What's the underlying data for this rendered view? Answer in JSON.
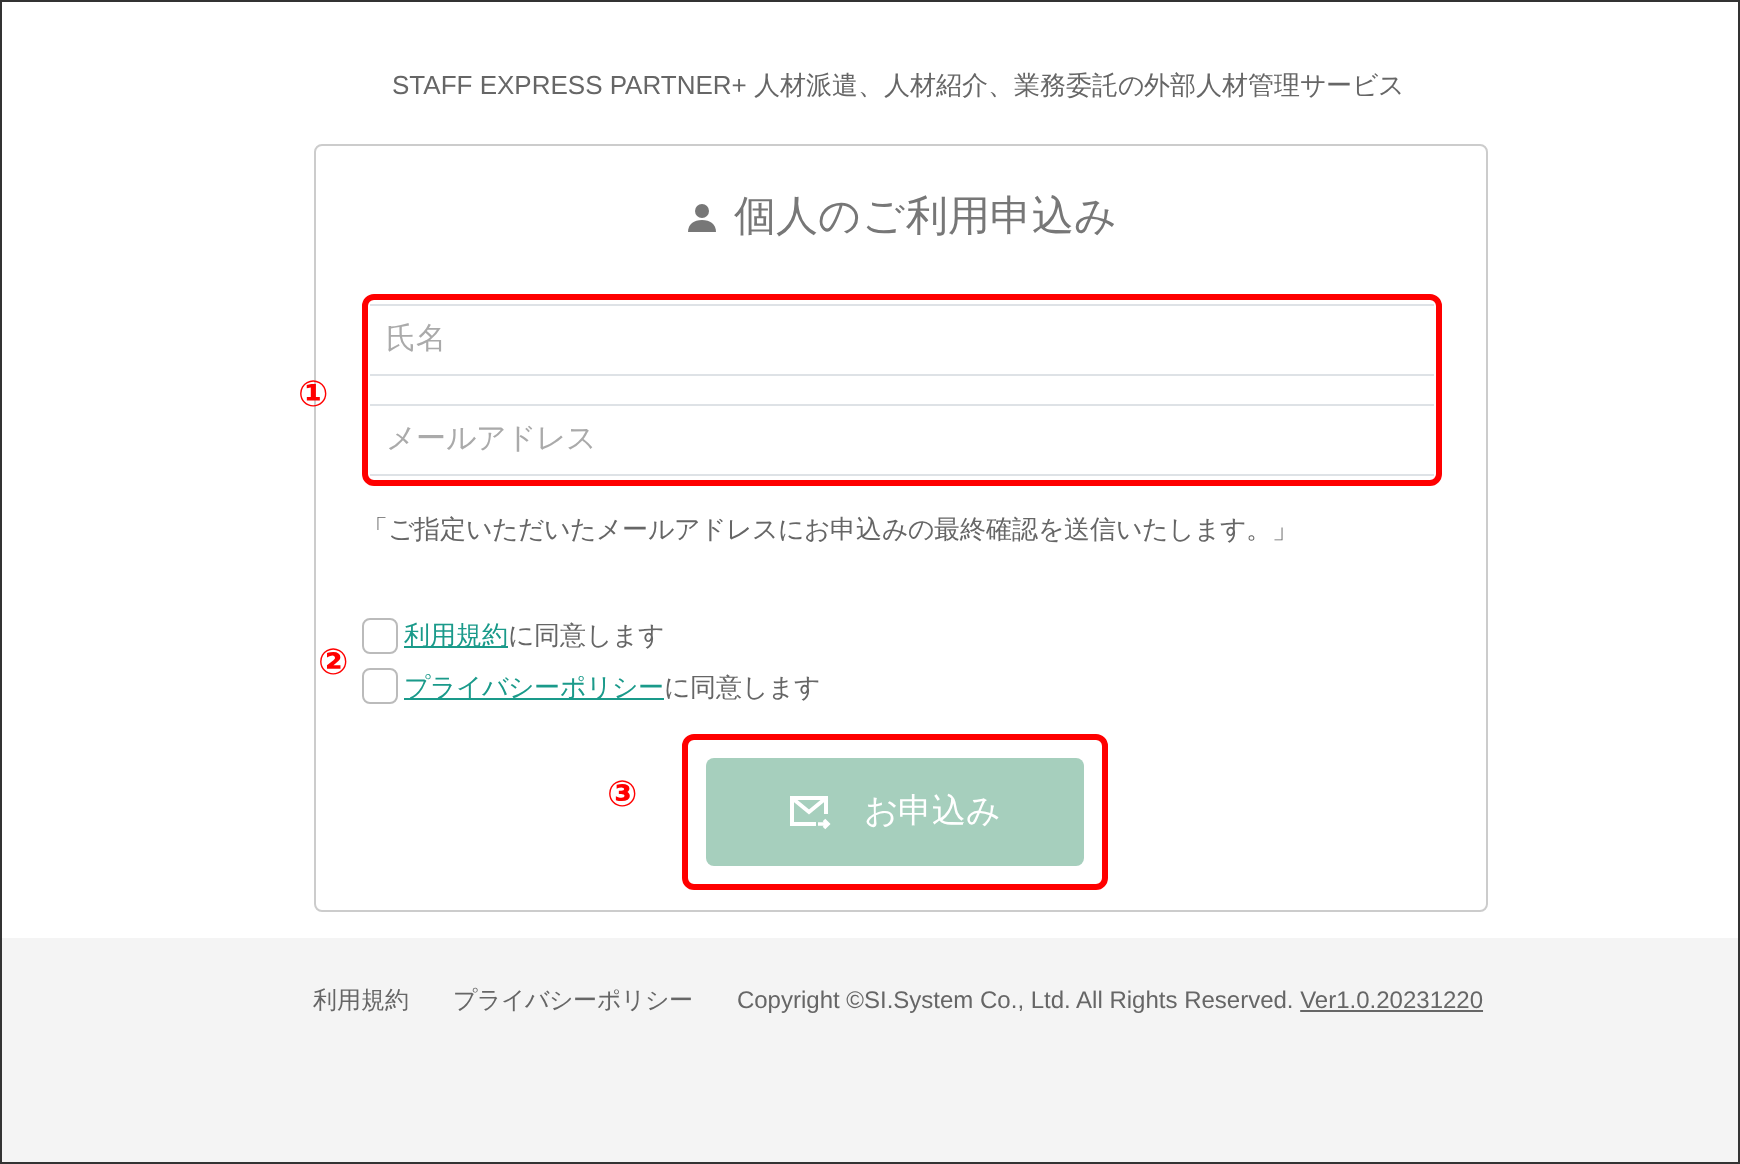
{
  "header": {
    "tagline": "STAFF EXPRESS PARTNER+ 人材派遣、人材紹介、業務委託の外部人材管理サービス"
  },
  "form": {
    "title": "個人のご利用申込み",
    "fields": [
      {
        "placeholder": "氏名"
      },
      {
        "placeholder": "メールアドレス"
      }
    ],
    "note": "「ご指定いただいたメールアドレスにお申込みの最終確認を送信いたします。」",
    "agreements": [
      {
        "link": "利用規約",
        "text": "に同意します",
        "checked": false
      },
      {
        "link": "プライバシーポリシー",
        "text": "に同意します",
        "checked": false
      }
    ],
    "submit": {
      "label": "お申込み",
      "disabled": true
    }
  },
  "annotations": [
    {
      "label": "①"
    },
    {
      "label": "②"
    },
    {
      "label": "③"
    }
  ],
  "footer": {
    "links": [
      "利用規約",
      "プライバシーポリシー"
    ],
    "copyright": "Copyright ©SI.System Co., Ltd. All Rights Reserved.",
    "version": "Ver1.0.20231220"
  }
}
